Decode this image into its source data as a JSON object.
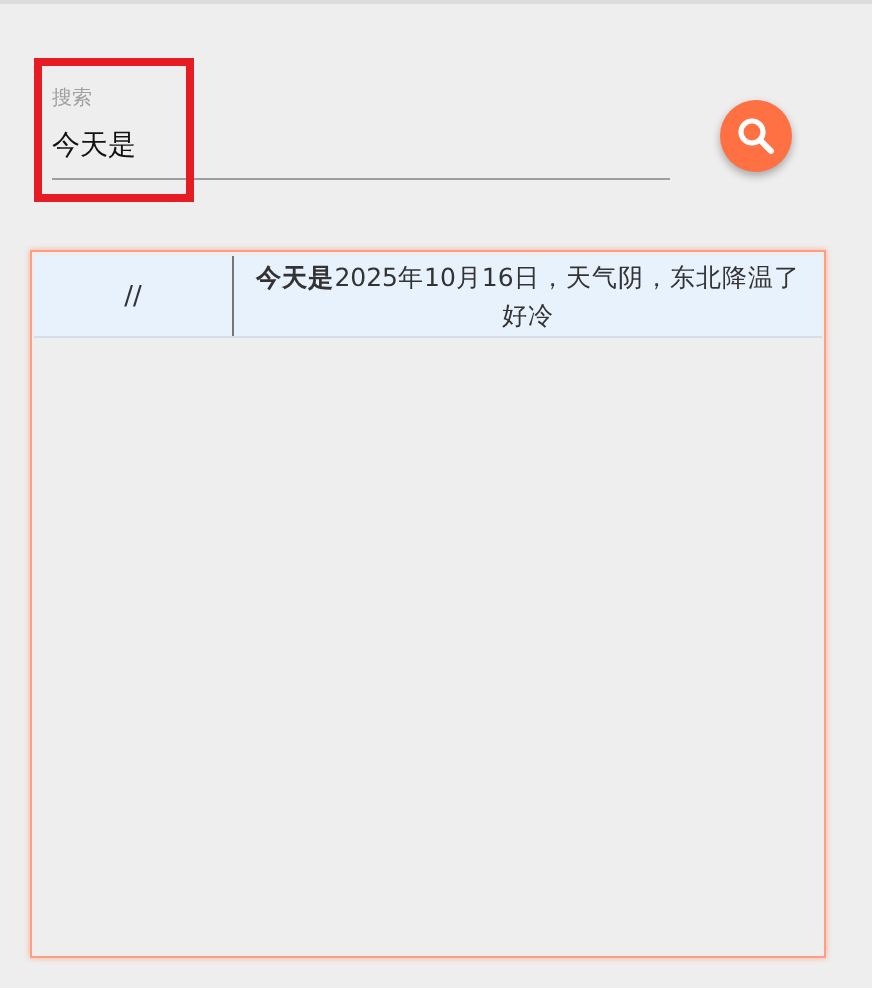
{
  "search": {
    "label": "搜索",
    "value": "今天是",
    "highlighted": true
  },
  "results": {
    "rows": [
      {
        "column_1": "//",
        "column_2": "**今天是**2025年10月16日，天气阴，东北降温了好冷",
        "selected": true
      }
    ]
  }
}
